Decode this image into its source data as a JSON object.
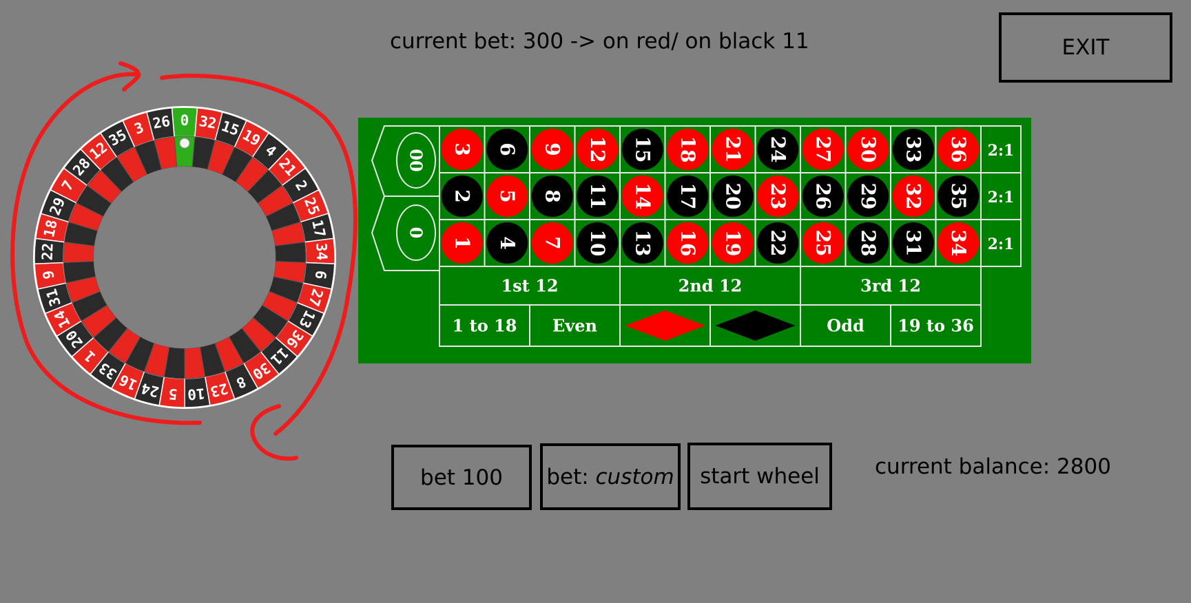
{
  "header": {
    "current_bet": "current bet: 300 -> on red/ on black 11"
  },
  "exit_button": {
    "label": "EXIT"
  },
  "balance": {
    "text": "current balance: 2800"
  },
  "controls": {
    "bet100_label": "bet 100",
    "custom_prefix": "bet: ",
    "custom_word": "custom",
    "start_label": "start wheel"
  },
  "table": {
    "zeros": [
      "00",
      "0"
    ],
    "rows": [
      [
        "3",
        "6",
        "9",
        "12",
        "15",
        "18",
        "21",
        "24",
        "27",
        "30",
        "33",
        "36"
      ],
      [
        "2",
        "5",
        "8",
        "11",
        "14",
        "17",
        "20",
        "23",
        "26",
        "29",
        "32",
        "35"
      ],
      [
        "1",
        "4",
        "7",
        "10",
        "13",
        "16",
        "19",
        "22",
        "25",
        "28",
        "31",
        "34"
      ]
    ],
    "red_numbers": [
      1,
      3,
      5,
      7,
      9,
      12,
      14,
      16,
      18,
      19,
      21,
      23,
      25,
      27,
      30,
      32,
      34,
      36
    ],
    "column_bets": [
      "2:1",
      "2:1",
      "2:1"
    ],
    "dozens": [
      "1st 12",
      "2nd 12",
      "3rd 12"
    ],
    "outside_bets": [
      "1 to 18",
      "Even",
      "Odd",
      "19 to 36"
    ],
    "colors": {
      "felt": "#008000",
      "red": "#ff0000",
      "black": "#000000",
      "lines": "#e8e8e8"
    }
  },
  "wheel": {
    "numbers": [
      "0",
      "32",
      "15",
      "19",
      "4",
      "21",
      "2",
      "25",
      "17",
      "34",
      "6",
      "27",
      "13",
      "36",
      "11",
      "30",
      "8",
      "23",
      "10",
      "5",
      "24",
      "16",
      "33",
      "1",
      "20",
      "14",
      "31",
      "9",
      "22",
      "18",
      "29",
      "7",
      "28",
      "12",
      "35",
      "3",
      "26"
    ],
    "colors": {
      "red": "#e8251f",
      "black": "#2a2a2a",
      "green": "#2fae1c",
      "arrow": "#ee1c1c"
    }
  }
}
